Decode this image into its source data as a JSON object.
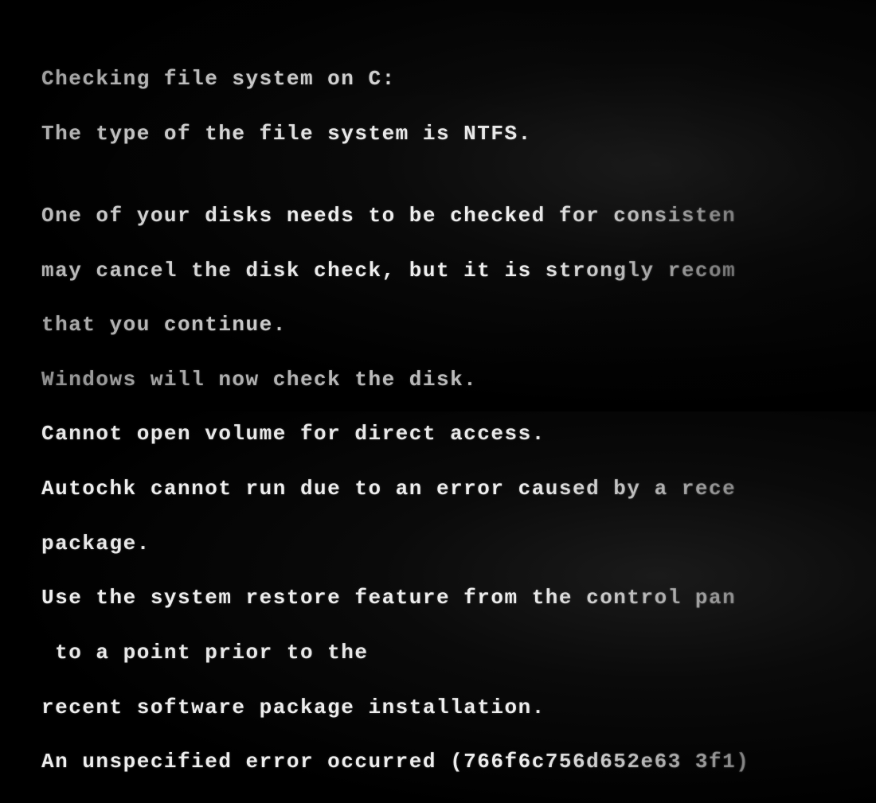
{
  "console": {
    "lines": [
      "Checking file system on C:",
      "The type of the file system is NTFS.",
      "",
      "One of your disks needs to be checked for consisten",
      "may cancel the disk check, but it is strongly recom",
      "that you continue.",
      "Windows will now check the disk.",
      "Cannot open volume for direct access.",
      "Autochk cannot run due to an error caused by a rece",
      "package.",
      "Use the system restore feature from the control pan",
      " to a point prior to the",
      "recent software package installation.",
      "An unspecified error occurred (766f6c756d652e63 3f1)"
    ]
  }
}
